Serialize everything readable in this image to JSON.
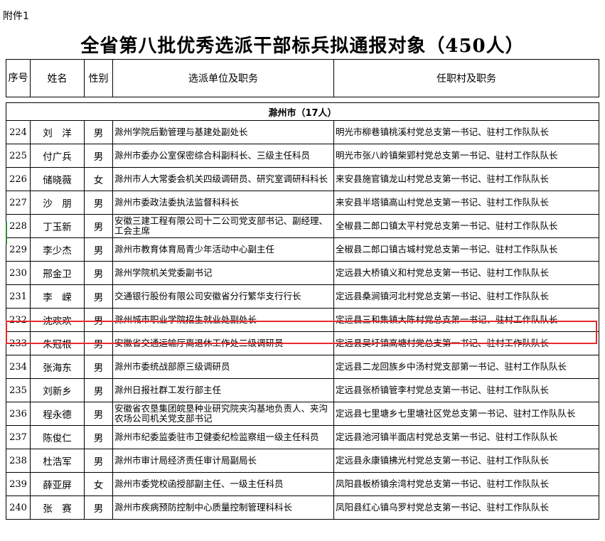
{
  "attachment_label": "附件1",
  "title": "全省第八批优秀选派干部标兵拟通报对象（450人）",
  "headers": {
    "seq": "序号",
    "name": "姓名",
    "gender": "性别",
    "unit": "选派单位及职务",
    "village": "任职村及职务"
  },
  "section": "滁州市（17人）",
  "rows": [
    {
      "num": "224",
      "name": "刘　洋",
      "gender": "男",
      "unit": "滁州学院后勤管理与基建处副处长",
      "village": "明光市柳巷镇桃溪村党总支第一书记、驻村工作队队长"
    },
    {
      "num": "225",
      "name": "付广兵",
      "gender": "男",
      "unit": "滁州市委办公室保密综合科副科长、三级主任科员",
      "village": "明光市张八岭镇柴郢村党总支第一书记、驻村工作队队长"
    },
    {
      "num": "226",
      "name": "储晓薇",
      "gender": "女",
      "unit": "滁州市人大常委会机关四级调研员、研究室调研科科长",
      "village": "来安县施官镇龙山村党总支第一书记、驻村工作队队长"
    },
    {
      "num": "227",
      "name": "沙　朋",
      "gender": "男",
      "unit": "滁州市委政法委执法监督科科长",
      "village": "来安县半塔镇高山村党总支第一书记、驻村工作队队长"
    },
    {
      "num": "228",
      "name": "丁玉新",
      "gender": "男",
      "unit": "安徽三建工程有限公司十二公司党支部书记、副经理、工会主席",
      "village": "全椒县二郎口镇太平村党总支第一书记、驻村工作队队长"
    },
    {
      "num": "229",
      "name": "李少杰",
      "gender": "男",
      "unit": "滁州市教育体育局青少年活动中心副主任",
      "village": "全椒县二郎口镇古城村党总支第一书记、驻村工作队队长"
    },
    {
      "num": "230",
      "name": "邢金卫",
      "gender": "男",
      "unit": "滁州学院机关党委副书记",
      "village": "定远县大桥镇义和村党总支第一书记、驻村工作队队长"
    },
    {
      "num": "231",
      "name": "李　嵘",
      "gender": "男",
      "unit": "交通银行股份有限公司安徽省分行繁华支行行长",
      "village": "定远县桑涧镇河北村党总支第一书记、驻村工作队队长"
    },
    {
      "num": "232",
      "name": "沈欢欢",
      "gender": "男",
      "unit": "滁州城市职业学院招生就业处副处长",
      "village": "定远县三和集镇大陈村党总支第一书记、驻村工作队队长"
    },
    {
      "num": "233",
      "name": "朱冠根",
      "gender": "男",
      "unit": "安徽省交通运输厅离退休工作处二级调研员",
      "village": "定远县吴圩镇高塘村党总支第一书记、驻村工作队队长"
    },
    {
      "num": "234",
      "name": "张海东",
      "gender": "男",
      "unit": "滁州市委统战部原三级调研员",
      "village": "定远县二龙回族乡中汤村党支部第一书记、驻村工作队队长"
    },
    {
      "num": "235",
      "name": "刘新乡",
      "gender": "男",
      "unit": "滁州日报社群工发行部主任",
      "village": "定远县张桥镇管李村党总支第一书记、驻村工作队队长"
    },
    {
      "num": "236",
      "name": "程永德",
      "gender": "男",
      "unit": "安徽省农垦集团皖垦种业研究院夹沟基地负责人、夹沟农场公司机关党支部书记",
      "village": "定远县七里塘乡七里塘社区党总支第一书记、驻村工作队队长"
    },
    {
      "num": "237",
      "name": "陈俊仁",
      "gender": "男",
      "unit": "滁州市纪委监委驻市卫健委纪检监察组一级主任科员",
      "village": "定远县池河镇半面店村党总支第一书记、驻村工作队队长"
    },
    {
      "num": "238",
      "name": "杜浩军",
      "gender": "男",
      "unit": "滁州市审计局经济责任审计局副局长",
      "village": "定远县永康镇拂光村党总支第一书记、驻村工作队队长"
    },
    {
      "num": "239",
      "name": "薛亚屏",
      "gender": "女",
      "unit": "滁州市委党校函授部副主任、一级主任科员",
      "village": "凤阳县板桥镇余湾村党总支第一书记、驻村工作队队长"
    },
    {
      "num": "240",
      "name": "张　赛",
      "gender": "男",
      "unit": "滁州市疾病预防控制中心质量控制管理科科长",
      "village": "凤阳县红心镇乌罗村党总支第一书记、驻村工作队队长"
    }
  ],
  "colors": {
    "highlight_border": "#e8292a",
    "grid_line": "#000000"
  }
}
